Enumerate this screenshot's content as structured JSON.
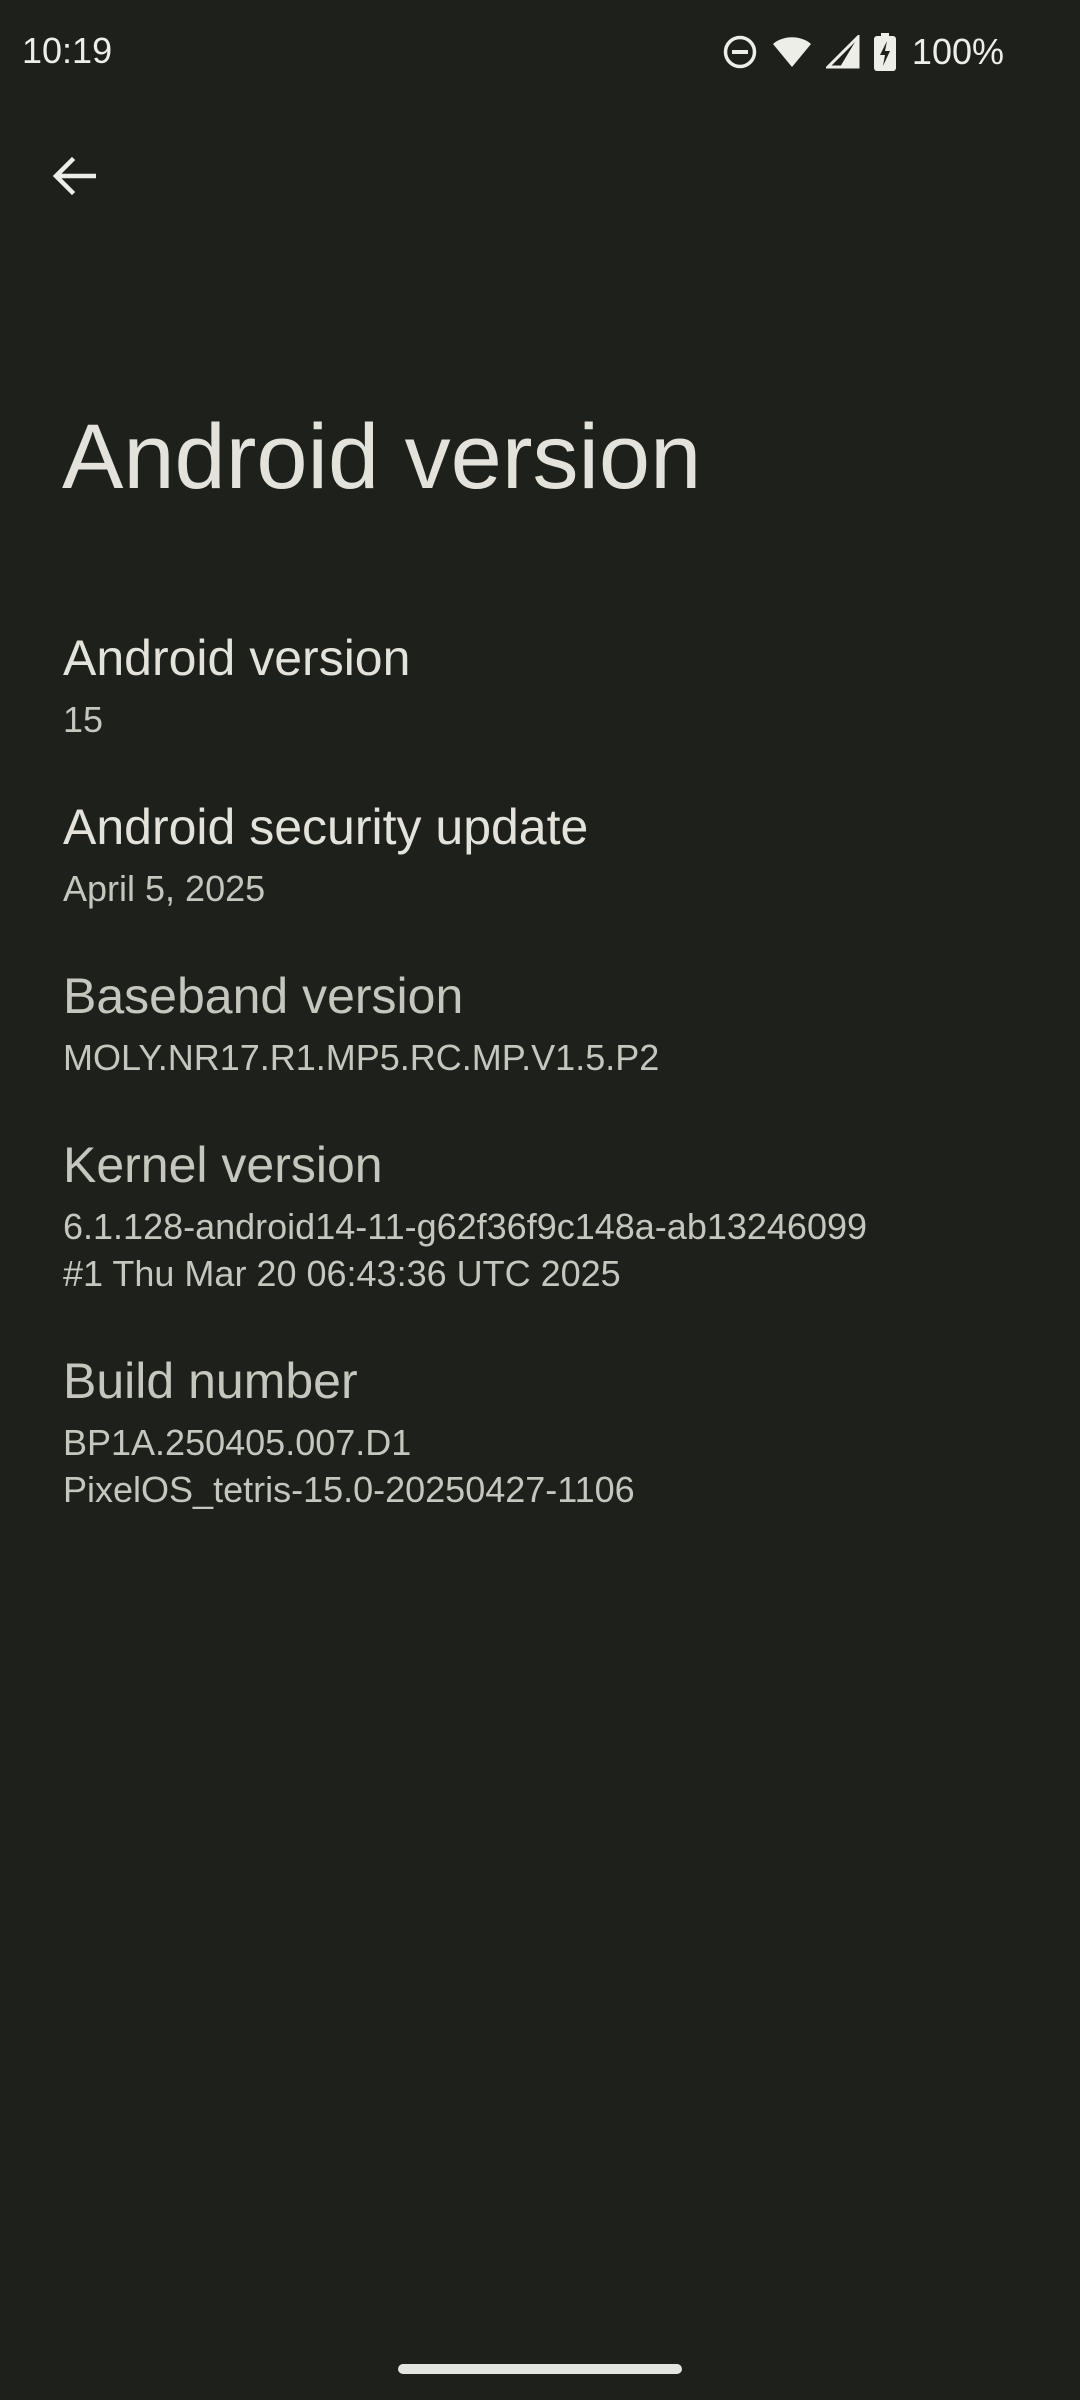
{
  "status_bar": {
    "time": "10:19",
    "battery_percent": "100%",
    "icons": [
      "do-not-disturb-icon",
      "wifi-icon",
      "cellular-signal-icon",
      "battery-charging-icon"
    ]
  },
  "header": {
    "back_icon": "arrow-back-icon",
    "title": "Android version"
  },
  "items": [
    {
      "title": "Android version",
      "summary": "15"
    },
    {
      "title": "Android security update",
      "summary": "April 5, 2025"
    },
    {
      "title": "Baseband version",
      "summary": "MOLY.NR17.R1.MP5.RC.MP.V1.5.P2"
    },
    {
      "title": "Kernel version",
      "summary": "6.1.128-android14-11-g62f36f9c148a-ab13246099\n#1 Thu Mar 20 06:43:36 UTC 2025"
    },
    {
      "title": "Build number",
      "summary": "BP1A.250405.007.D1\nPixelOS_tetris-15.0-20250427-1106"
    }
  ],
  "colors": {
    "background": "#1e201c",
    "text_primary": "#e3e3dc",
    "text_secondary": "#c5c7be"
  }
}
